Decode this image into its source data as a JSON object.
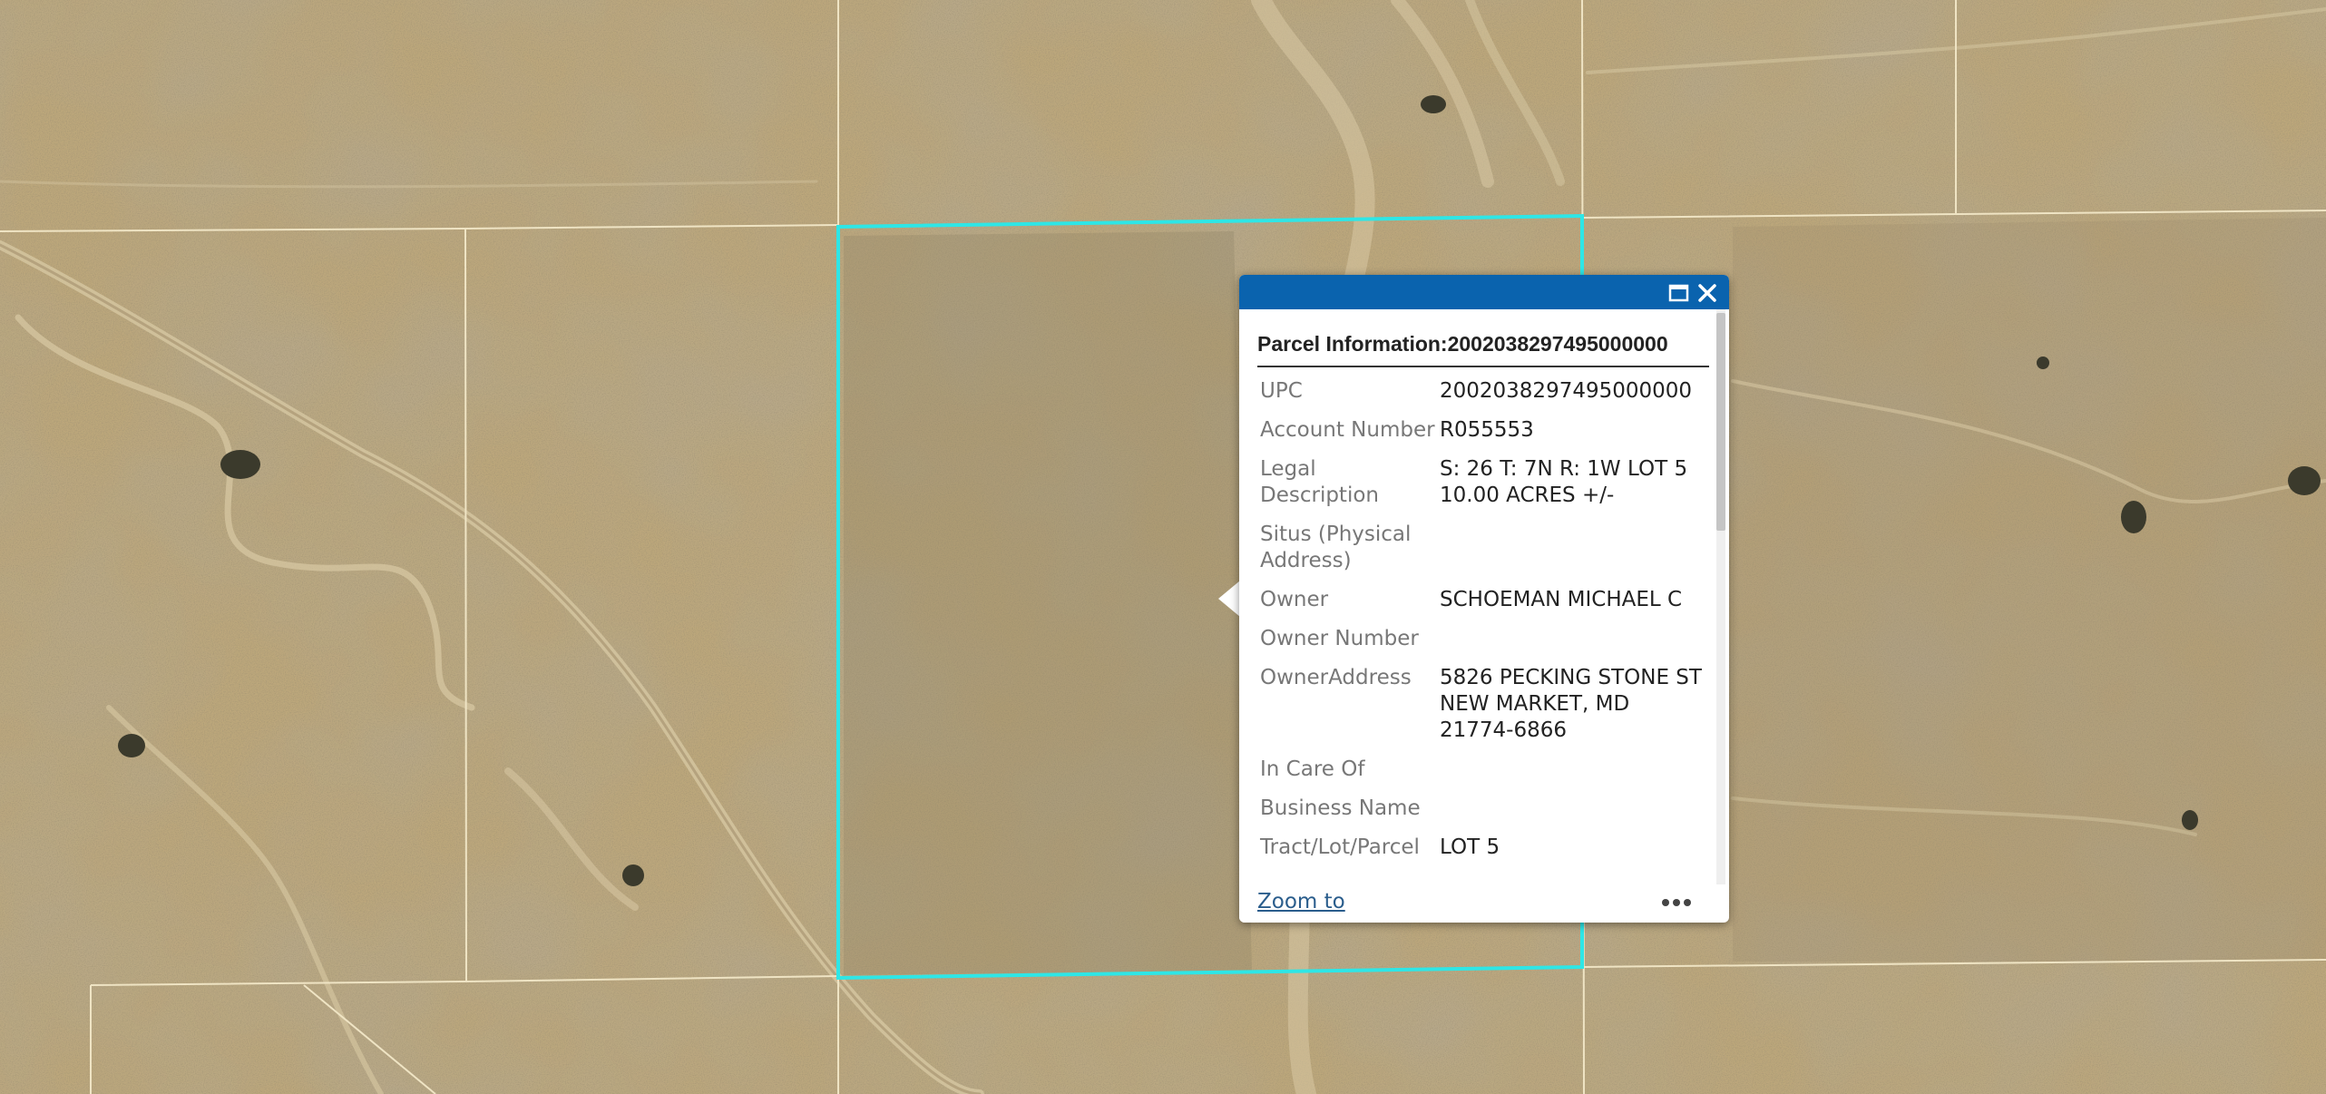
{
  "map": {
    "basemap": "aerial-imagery",
    "selected_parcel_color": "#2ee6e6",
    "parcel_line_color": "#efe4c4"
  },
  "popup": {
    "header_color": "#0a63ae",
    "maximize_icon": "maximize-icon",
    "close_icon": "close-icon",
    "title": "Parcel Information:2002038297495000000",
    "fields": [
      {
        "label": "UPC",
        "value": "2002038297495000000"
      },
      {
        "label": "Account Number",
        "value": "R055553"
      },
      {
        "label": "Legal Description",
        "value": "S: 26 T: 7N R: 1W LOT 5 10.00 ACRES +/-"
      },
      {
        "label": "Situs (Physical Address)",
        "value": ""
      },
      {
        "label": "Owner",
        "value": "SCHOEMAN MICHAEL C"
      },
      {
        "label": "Owner Number",
        "value": ""
      },
      {
        "label": "OwnerAddress",
        "value": "5826 PECKING STONE ST NEW MARKET, MD 21774-6866"
      },
      {
        "label": "In Care Of",
        "value": ""
      },
      {
        "label": "Business Name",
        "value": ""
      },
      {
        "label": "Tract/Lot/Parcel",
        "value": "LOT 5"
      }
    ],
    "zoom_link": "Zoom to",
    "more_icon": "more-options-icon"
  }
}
